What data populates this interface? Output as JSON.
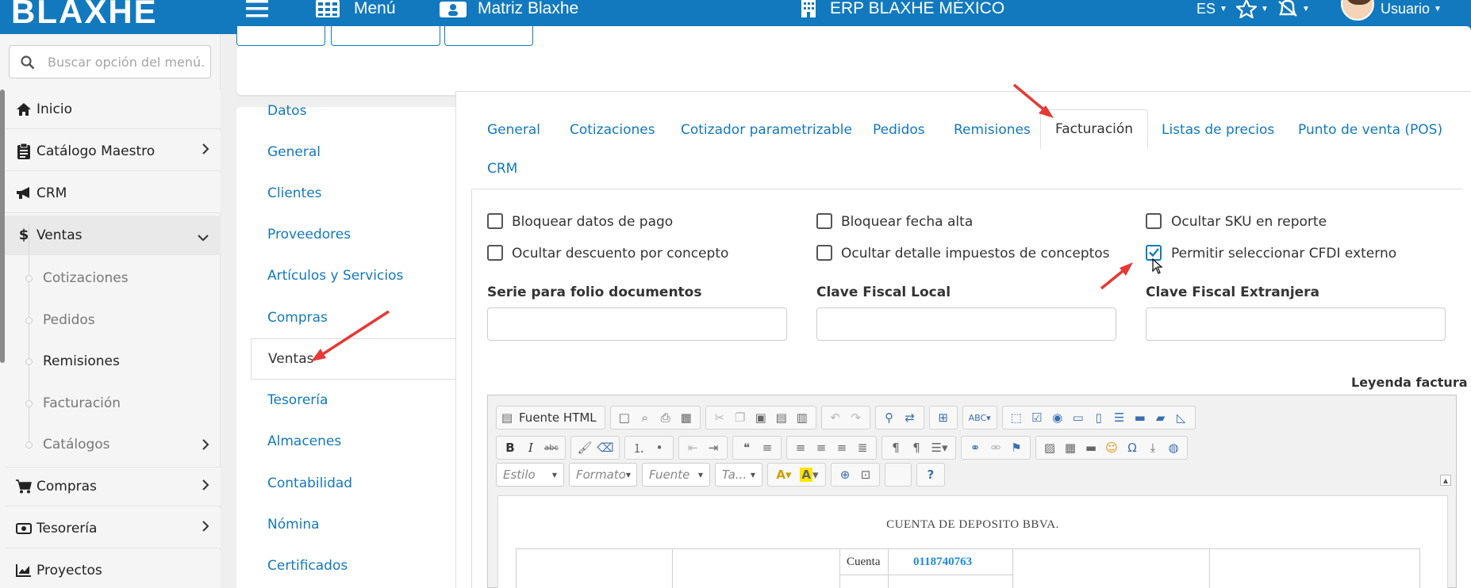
{
  "topbar": {
    "logo": "BLAXHE",
    "menu_label": "Menú",
    "matriz_label": "Matriz Blaxhe",
    "company_label": "ERP BLAXHE MÉXICO",
    "lang_label": "ES",
    "user_label": "Usuario",
    "bg_color": "#1279be"
  },
  "sidebar": {
    "search_placeholder": "Buscar opción del menú...",
    "items": [
      {
        "label": "Inicio",
        "icon": "home-icon"
      },
      {
        "label": "Catálogo Maestro",
        "icon": "clipboard-icon"
      },
      {
        "label": "CRM",
        "icon": "bullhorn-icon"
      },
      {
        "label": "Ventas",
        "icon": "dollar-icon"
      }
    ],
    "subitems": [
      "Cotizaciones",
      "Pedidos",
      "Remisiones",
      "Facturación",
      "Catálogos"
    ],
    "lower_items": [
      {
        "label": "Compras",
        "icon": "cart-icon"
      },
      {
        "label": "Tesorería",
        "icon": "money-icon"
      },
      {
        "label": "Proyectos",
        "icon": "chart-icon"
      }
    ]
  },
  "vtabs": [
    "Datos",
    "General",
    "Clientes",
    "Proveedores",
    "Artículos y Servicios",
    "Compras",
    "Ventas",
    "Tesorería",
    "Almacenes",
    "Contabilidad",
    "Nómina",
    "Certificados"
  ],
  "htabs": [
    "General",
    "Cotizaciones",
    "Cotizador parametrizable",
    "Pedidos",
    "Remisiones",
    "Facturación",
    "Listas de precios",
    "Punto de venta (POS)",
    "CRM"
  ],
  "checks": {
    "bloquear_pago": "Bloquear datos de pago",
    "bloquear_fecha": "Bloquear fecha alta",
    "ocultar_sku": "Ocultar SKU en reporte",
    "ocultar_descuento": "Ocultar descuento por concepto",
    "ocultar_detalle": "Ocultar detalle impuestos de conceptos",
    "permitir_cfdi": "Permitir seleccionar CFDI externo"
  },
  "fields": {
    "serie_label": "Serie para folio documentos",
    "serie_value": "",
    "clave_local_label": "Clave Fiscal Local",
    "clave_local_value": "",
    "clave_ext_label": "Clave Fiscal Extranjera",
    "clave_ext_value": ""
  },
  "editor": {
    "leyenda_label": "Leyenda factura",
    "source_label": "Fuente HTML",
    "combo_estilo": "Estilo",
    "combo_formato": "Formato",
    "combo_fuente": "Fuente",
    "combo_tamano": "Ta...",
    "doc_title": "CUENTA DE DEPOSITO BBVA.",
    "cuenta_label": "Cuenta",
    "cuenta_value": "0118740763"
  }
}
